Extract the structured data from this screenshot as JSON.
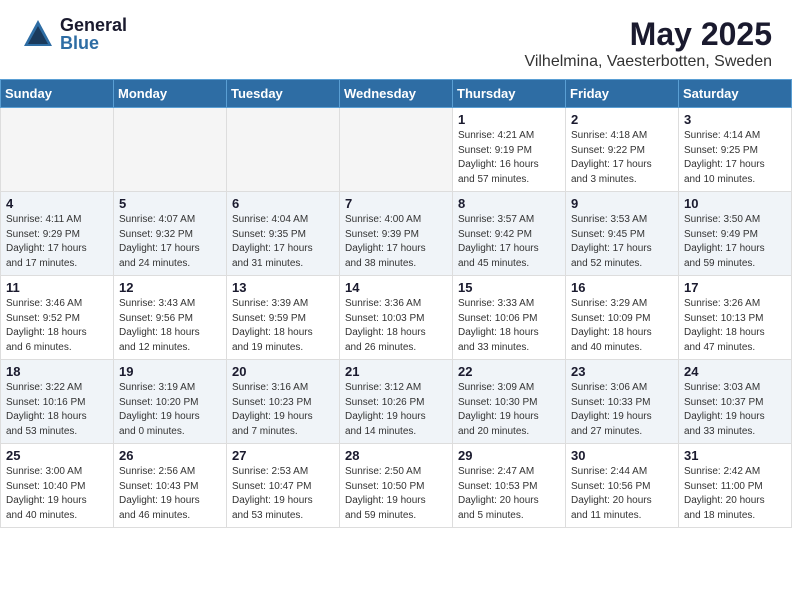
{
  "header": {
    "logo_general": "General",
    "logo_blue": "Blue",
    "month_year": "May 2025",
    "location": "Vilhelmina, Vaesterbotten, Sweden"
  },
  "weekdays": [
    "Sunday",
    "Monday",
    "Tuesday",
    "Wednesday",
    "Thursday",
    "Friday",
    "Saturday"
  ],
  "weeks": [
    [
      {
        "day": "",
        "info": ""
      },
      {
        "day": "",
        "info": ""
      },
      {
        "day": "",
        "info": ""
      },
      {
        "day": "",
        "info": ""
      },
      {
        "day": "1",
        "info": "Sunrise: 4:21 AM\nSunset: 9:19 PM\nDaylight: 16 hours\nand 57 minutes."
      },
      {
        "day": "2",
        "info": "Sunrise: 4:18 AM\nSunset: 9:22 PM\nDaylight: 17 hours\nand 3 minutes."
      },
      {
        "day": "3",
        "info": "Sunrise: 4:14 AM\nSunset: 9:25 PM\nDaylight: 17 hours\nand 10 minutes."
      }
    ],
    [
      {
        "day": "4",
        "info": "Sunrise: 4:11 AM\nSunset: 9:29 PM\nDaylight: 17 hours\nand 17 minutes."
      },
      {
        "day": "5",
        "info": "Sunrise: 4:07 AM\nSunset: 9:32 PM\nDaylight: 17 hours\nand 24 minutes."
      },
      {
        "day": "6",
        "info": "Sunrise: 4:04 AM\nSunset: 9:35 PM\nDaylight: 17 hours\nand 31 minutes."
      },
      {
        "day": "7",
        "info": "Sunrise: 4:00 AM\nSunset: 9:39 PM\nDaylight: 17 hours\nand 38 minutes."
      },
      {
        "day": "8",
        "info": "Sunrise: 3:57 AM\nSunset: 9:42 PM\nDaylight: 17 hours\nand 45 minutes."
      },
      {
        "day": "9",
        "info": "Sunrise: 3:53 AM\nSunset: 9:45 PM\nDaylight: 17 hours\nand 52 minutes."
      },
      {
        "day": "10",
        "info": "Sunrise: 3:50 AM\nSunset: 9:49 PM\nDaylight: 17 hours\nand 59 minutes."
      }
    ],
    [
      {
        "day": "11",
        "info": "Sunrise: 3:46 AM\nSunset: 9:52 PM\nDaylight: 18 hours\nand 6 minutes."
      },
      {
        "day": "12",
        "info": "Sunrise: 3:43 AM\nSunset: 9:56 PM\nDaylight: 18 hours\nand 12 minutes."
      },
      {
        "day": "13",
        "info": "Sunrise: 3:39 AM\nSunset: 9:59 PM\nDaylight: 18 hours\nand 19 minutes."
      },
      {
        "day": "14",
        "info": "Sunrise: 3:36 AM\nSunset: 10:03 PM\nDaylight: 18 hours\nand 26 minutes."
      },
      {
        "day": "15",
        "info": "Sunrise: 3:33 AM\nSunset: 10:06 PM\nDaylight: 18 hours\nand 33 minutes."
      },
      {
        "day": "16",
        "info": "Sunrise: 3:29 AM\nSunset: 10:09 PM\nDaylight: 18 hours\nand 40 minutes."
      },
      {
        "day": "17",
        "info": "Sunrise: 3:26 AM\nSunset: 10:13 PM\nDaylight: 18 hours\nand 47 minutes."
      }
    ],
    [
      {
        "day": "18",
        "info": "Sunrise: 3:22 AM\nSunset: 10:16 PM\nDaylight: 18 hours\nand 53 minutes."
      },
      {
        "day": "19",
        "info": "Sunrise: 3:19 AM\nSunset: 10:20 PM\nDaylight: 19 hours\nand 0 minutes."
      },
      {
        "day": "20",
        "info": "Sunrise: 3:16 AM\nSunset: 10:23 PM\nDaylight: 19 hours\nand 7 minutes."
      },
      {
        "day": "21",
        "info": "Sunrise: 3:12 AM\nSunset: 10:26 PM\nDaylight: 19 hours\nand 14 minutes."
      },
      {
        "day": "22",
        "info": "Sunrise: 3:09 AM\nSunset: 10:30 PM\nDaylight: 19 hours\nand 20 minutes."
      },
      {
        "day": "23",
        "info": "Sunrise: 3:06 AM\nSunset: 10:33 PM\nDaylight: 19 hours\nand 27 minutes."
      },
      {
        "day": "24",
        "info": "Sunrise: 3:03 AM\nSunset: 10:37 PM\nDaylight: 19 hours\nand 33 minutes."
      }
    ],
    [
      {
        "day": "25",
        "info": "Sunrise: 3:00 AM\nSunset: 10:40 PM\nDaylight: 19 hours\nand 40 minutes."
      },
      {
        "day": "26",
        "info": "Sunrise: 2:56 AM\nSunset: 10:43 PM\nDaylight: 19 hours\nand 46 minutes."
      },
      {
        "day": "27",
        "info": "Sunrise: 2:53 AM\nSunset: 10:47 PM\nDaylight: 19 hours\nand 53 minutes."
      },
      {
        "day": "28",
        "info": "Sunrise: 2:50 AM\nSunset: 10:50 PM\nDaylight: 19 hours\nand 59 minutes."
      },
      {
        "day": "29",
        "info": "Sunrise: 2:47 AM\nSunset: 10:53 PM\nDaylight: 20 hours\nand 5 minutes."
      },
      {
        "day": "30",
        "info": "Sunrise: 2:44 AM\nSunset: 10:56 PM\nDaylight: 20 hours\nand 11 minutes."
      },
      {
        "day": "31",
        "info": "Sunrise: 2:42 AM\nSunset: 11:00 PM\nDaylight: 20 hours\nand 18 minutes."
      }
    ]
  ]
}
